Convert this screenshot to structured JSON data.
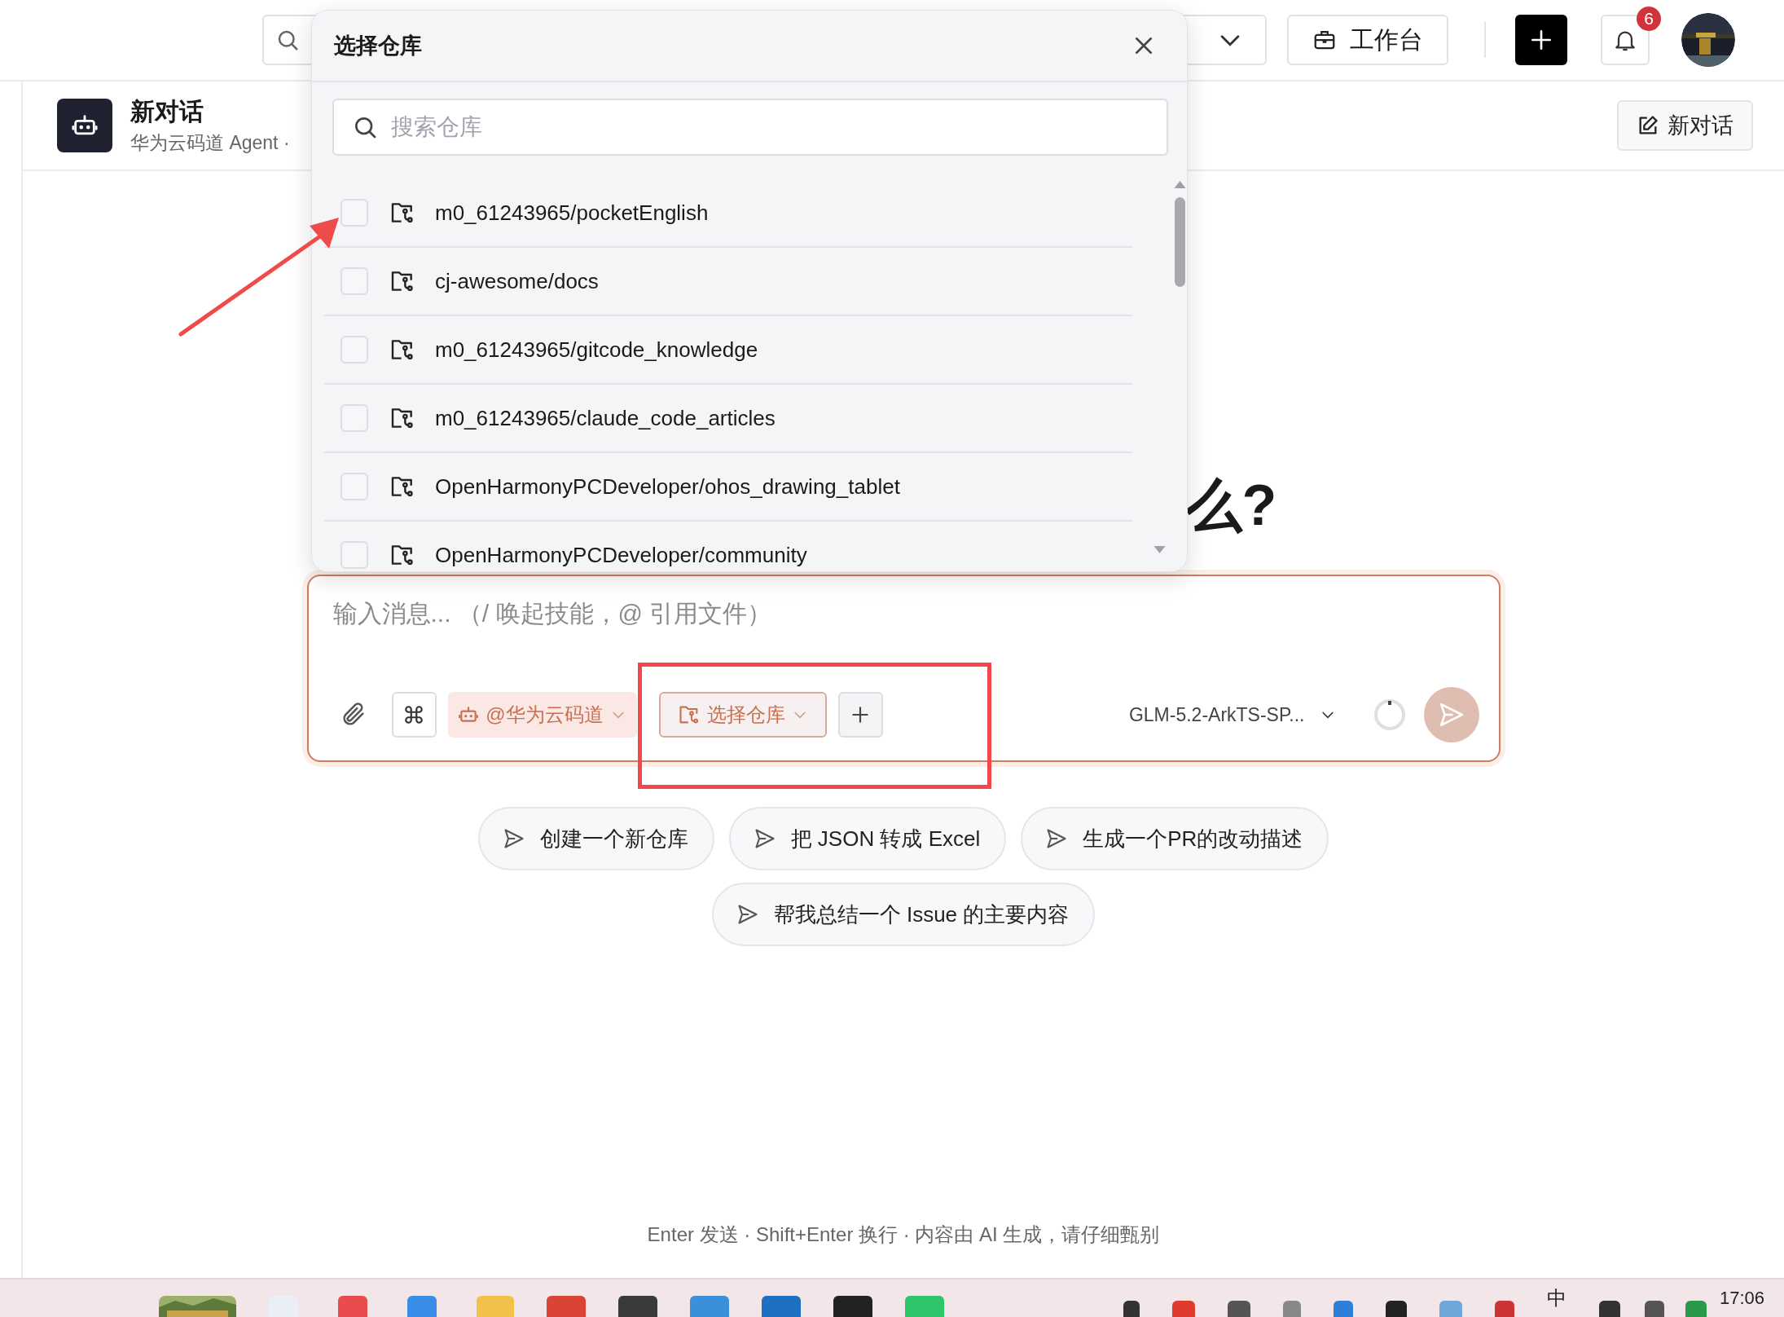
{
  "top_bar": {
    "workbench_label": "工作台",
    "notification_count": "6"
  },
  "header": {
    "title": "新对话",
    "subtitle": "华为云码道 Agent ·",
    "new_chat_label": "新对话"
  },
  "heading": "么?",
  "dialog": {
    "title": "选择仓库",
    "search": {
      "placeholder": "搜索仓库"
    },
    "repos": [
      {
        "name": "m0_61243965/pocketEnglish",
        "checked": false
      },
      {
        "name": "cj-awesome/docs",
        "checked": false
      },
      {
        "name": "m0_61243965/gitcode_knowledge",
        "checked": false
      },
      {
        "name": "m0_61243965/claude_code_articles",
        "checked": false
      },
      {
        "name": "OpenHarmonyPCDeveloper/ohos_drawing_tablet",
        "checked": false
      },
      {
        "name": "OpenHarmonyPCDeveloper/community",
        "checked": false
      }
    ]
  },
  "composer": {
    "placeholder": "输入消息... （/ 唤起技能，@ 引用文件）",
    "agent": "@华为云码道",
    "repo_button": "选择仓库",
    "model": "GLM-5.2-ArkTS-SP..."
  },
  "suggestions": [
    "创建一个新仓库",
    "把 JSON 转成 Excel",
    "生成一个PR的改动描述",
    "帮我总结一个 Issue 的主要内容"
  ],
  "footer_note": "Enter 发送 · Shift+Enter 换行 · 内容由 AI 生成，请仔细甄别",
  "taskbar": {
    "input_method": "中",
    "time": "17:06"
  }
}
